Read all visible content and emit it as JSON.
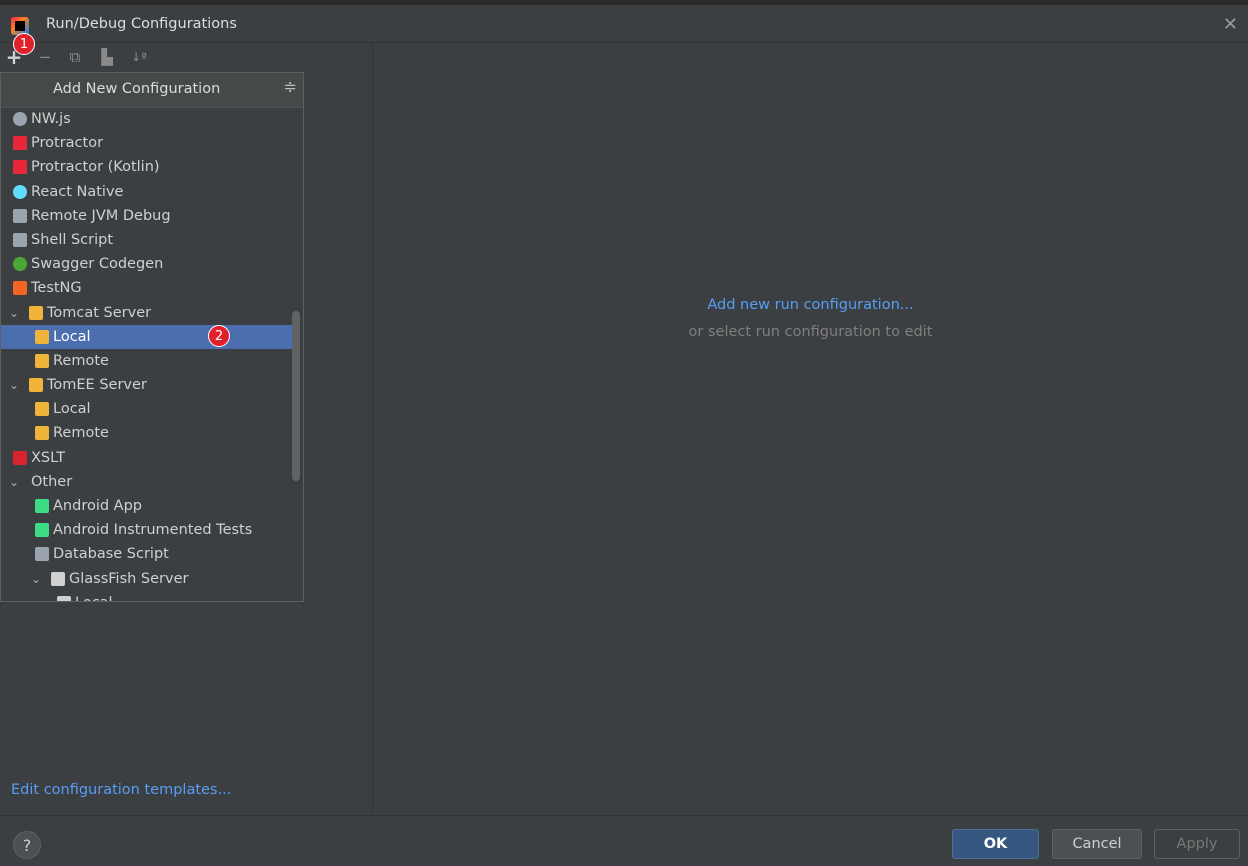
{
  "window": {
    "title": "Run/Debug Configurations",
    "close_glyph": "✕"
  },
  "toolbar": {
    "add": "+",
    "remove": "−",
    "copy": "⧉",
    "folder": "▙",
    "sort": "↓ª"
  },
  "badges": {
    "first": "1",
    "second": "2"
  },
  "popup": {
    "title": "Add New Configuration",
    "collapse_glyph": "≑",
    "items": [
      {
        "label": "NW.js",
        "icon": "nwjs-icon",
        "color": "#9aa4ae"
      },
      {
        "label": "Protractor",
        "icon": "protractor-icon",
        "color": "#e8283a"
      },
      {
        "label": "Protractor (Kotlin)",
        "icon": "protractor-icon",
        "color": "#e8283a"
      },
      {
        "label": "React Native",
        "icon": "react-icon",
        "color": "#61dafb"
      },
      {
        "label": "Remote JVM Debug",
        "icon": "remote-debug-icon",
        "color": "#9aa4ae"
      },
      {
        "label": "Shell Script",
        "icon": "shell-icon",
        "color": "#9aa4ae"
      },
      {
        "label": "Swagger Codegen",
        "icon": "swagger-icon",
        "color": "#49a834"
      },
      {
        "label": "TestNG",
        "icon": "testng-icon",
        "color": "#f26522"
      },
      {
        "label": "Tomcat Server",
        "icon": "tomcat-icon",
        "color": "#f0b43a",
        "expanded": true
      },
      {
        "label": "Local",
        "icon": "tomcat-icon",
        "color": "#f0b43a"
      },
      {
        "label": "Remote",
        "icon": "tomcat-icon",
        "color": "#f0b43a"
      },
      {
        "label": "TomEE Server",
        "icon": "tomee-icon",
        "color": "#f0b43a",
        "expanded": true
      },
      {
        "label": "Local",
        "icon": "tomee-icon",
        "color": "#f0b43a"
      },
      {
        "label": "Remote",
        "icon": "tomee-icon",
        "color": "#f0b43a"
      },
      {
        "label": "XSLT",
        "icon": "xslt-icon",
        "color": "#d9232e"
      },
      {
        "label": "Other",
        "icon": "",
        "color": "",
        "expanded": true
      },
      {
        "label": "Android App",
        "icon": "android-icon",
        "color": "#3ddc84"
      },
      {
        "label": "Android Instrumented Tests",
        "icon": "android-icon",
        "color": "#3ddc84"
      },
      {
        "label": "Database Script",
        "icon": "database-script-icon",
        "color": "#9aa4ae"
      },
      {
        "label": "GlassFish Server",
        "icon": "glassfish-icon",
        "color": "#d0d0d0",
        "expanded": true
      },
      {
        "label": "Local",
        "icon": "glassfish-icon",
        "color": "#d0d0d0"
      }
    ]
  },
  "left": {
    "edit_templates": "Edit configuration templates..."
  },
  "right": {
    "add_new": "Add new run configuration...",
    "or_select": "or select run configuration to edit"
  },
  "footer": {
    "help": "?",
    "ok": "OK",
    "cancel": "Cancel",
    "apply": "Apply"
  },
  "colors": {
    "accent": "#589df6",
    "selection": "#4b6eaf",
    "badge": "#e0212a"
  }
}
